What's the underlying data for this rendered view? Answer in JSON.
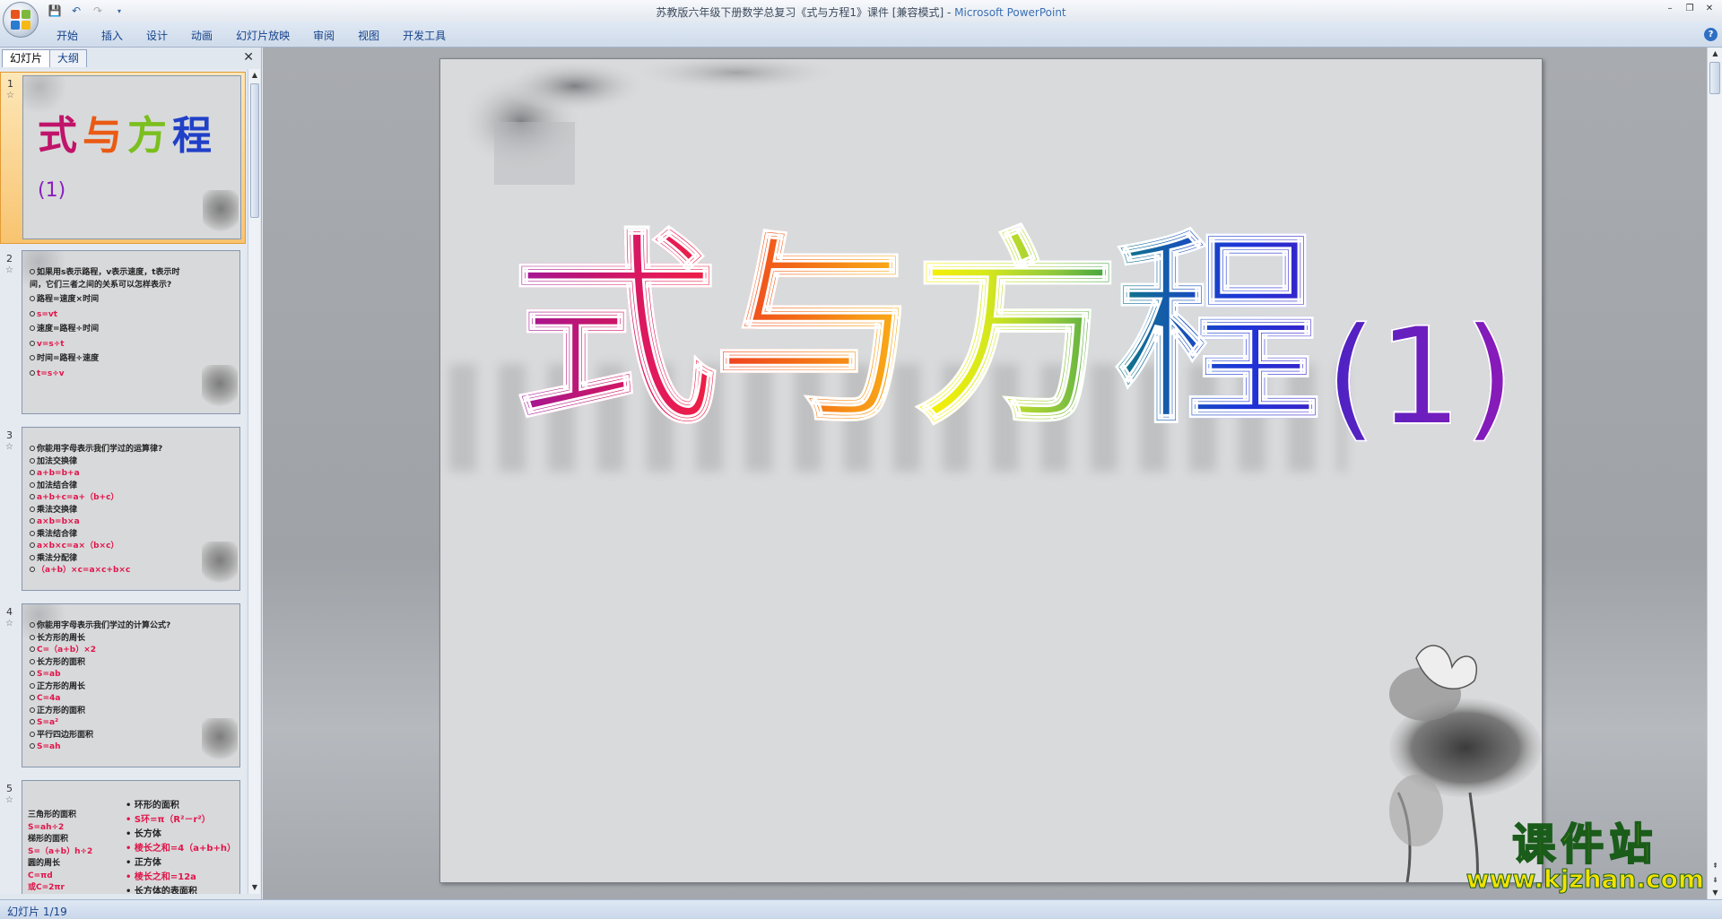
{
  "titlebar": {
    "document": "苏教版六年级下册数学总复习《式与方程1》课件 [兼容模式] - ",
    "app": "Microsoft PowerPoint",
    "minimize": "–",
    "restore": "❐",
    "close": "✕"
  },
  "ribbon": {
    "tabs": [
      "开始",
      "插入",
      "设计",
      "动画",
      "幻灯片放映",
      "审阅",
      "视图",
      "开发工具"
    ],
    "help": "?"
  },
  "panel": {
    "tab_slides": "幻灯片",
    "tab_outline": "大纲",
    "close": "✕"
  },
  "thumbnails": [
    {
      "num": "1",
      "title": "式与方程",
      "sub": "(1)"
    },
    {
      "num": "2",
      "lines": [
        {
          "t": "如果用s表示路程，v表示速度，t表示时",
          "red": false
        },
        {
          "t": "  间，它们三者之间的关系可以怎样表示?",
          "red": false
        },
        {
          "t": "路程=速度×时间",
          "red": false
        },
        {
          "t": "s=vt",
          "red": true
        },
        {
          "t": "速度=路程÷时间",
          "red": false
        },
        {
          "t": "v=s÷t",
          "red": true
        },
        {
          "t": "时间=路程÷速度",
          "red": false
        },
        {
          "t": "t=s÷v",
          "red": true
        }
      ]
    },
    {
      "num": "3",
      "lines": [
        {
          "t": "你能用字母表示我们学过的运算律?",
          "red": false
        },
        {
          "t": "加法交换律",
          "red": false
        },
        {
          "t": "a+b=b+a",
          "red": true
        },
        {
          "t": "加法结合律",
          "red": false
        },
        {
          "t": "a+b+c=a+（b+c）",
          "red": true
        },
        {
          "t": "乘法交换律",
          "red": false
        },
        {
          "t": "a×b=b×a",
          "red": true
        },
        {
          "t": "乘法结合律",
          "red": false
        },
        {
          "t": "a×b×c=a×（b×c）",
          "red": true
        },
        {
          "t": "乘法分配律",
          "red": false
        },
        {
          "t": "（a+b）×c=a×c+b×c",
          "red": true
        }
      ]
    },
    {
      "num": "4",
      "lines": [
        {
          "t": "你能用字母表示我们学过的计算公式?",
          "red": false
        },
        {
          "t": "长方形的周长",
          "red": false
        },
        {
          "t": "C=（a+b）×2",
          "red": true
        },
        {
          "t": "长方形的面积",
          "red": false
        },
        {
          "t": "S=ab",
          "red": true
        },
        {
          "t": "正方形的周长",
          "red": false
        },
        {
          "t": "C=4a",
          "red": true
        },
        {
          "t": "正方形的面积",
          "red": false
        },
        {
          "t": "S=a²",
          "red": true
        },
        {
          "t": "平行四边形面积",
          "red": false
        },
        {
          "t": "S=ah",
          "red": true
        }
      ]
    },
    {
      "num": "5",
      "left": [
        {
          "t": "三角形的面积",
          "red": false
        },
        {
          "t": "S=ah÷2",
          "red": true
        },
        {
          "t": "梯形的面积",
          "red": false
        },
        {
          "t": "S=（a+b）h÷2",
          "red": true
        },
        {
          "t": "圆的周长",
          "red": false
        },
        {
          "t": "C=πd",
          "red": true
        },
        {
          "t": "或C=2πr",
          "red": true
        }
      ],
      "right": [
        {
          "t": "环形的面积",
          "red": false
        },
        {
          "t": "S环=π（R²－r²）",
          "red": true
        },
        {
          "t": "长方体",
          "red": false
        },
        {
          "t": "棱长之和=4（a+b+h）",
          "red": true
        },
        {
          "t": "正方体",
          "red": false
        },
        {
          "t": "棱长之和=12a",
          "red": true
        },
        {
          "t": "长方体的表面积",
          "red": false
        }
      ]
    }
  ],
  "slide": {
    "chars": [
      "式",
      "与",
      "方",
      "程"
    ],
    "sub": "(1)"
  },
  "status": {
    "text": "幻灯片 1/19"
  },
  "watermark": {
    "main": "课件站",
    "url": "www.kjzhan.com"
  }
}
